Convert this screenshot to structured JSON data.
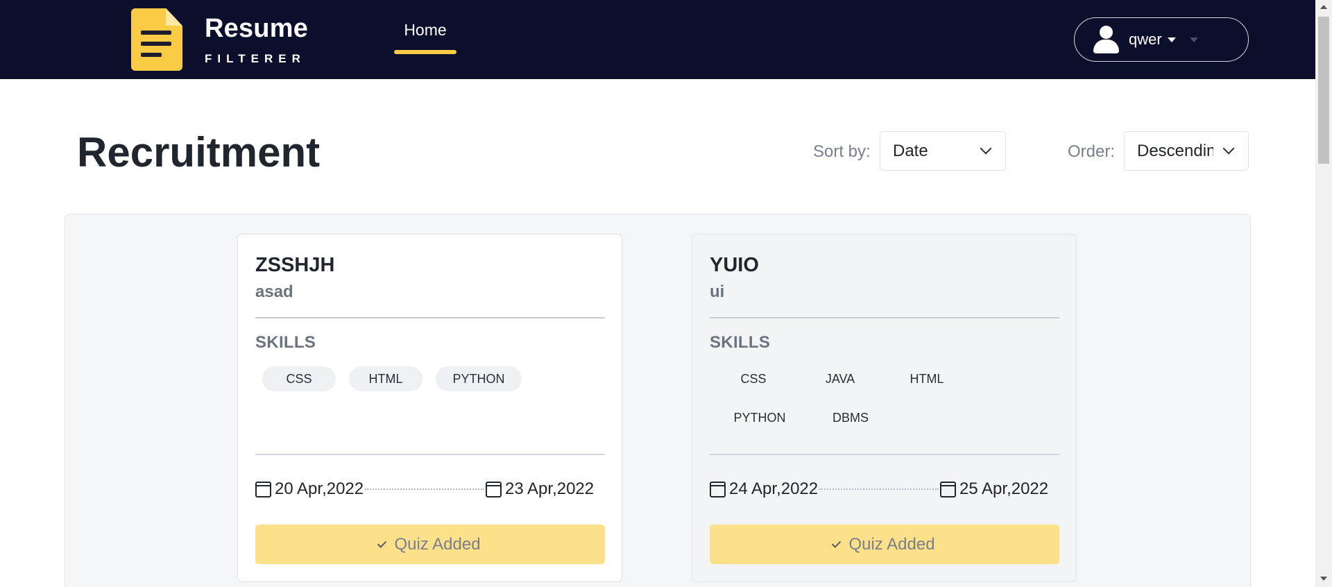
{
  "app": {
    "logo_title": "Resume",
    "logo_subtitle": "FILTERER",
    "nav_home": "Home",
    "user_name": "qwer"
  },
  "page": {
    "title": "Recruitment",
    "sort_label": "Sort by:",
    "sort_value": "Date",
    "order_label": "Order:",
    "order_value": "Descending"
  },
  "cards": [
    {
      "title": "ZSSHJH",
      "subtitle": "asad",
      "skills_heading": "SKILLS",
      "skills": [
        "CSS",
        "HTML",
        "PYTHON"
      ],
      "start_date": "20 Apr,2022",
      "end_date": "23 Apr,2022",
      "button_label": "Quiz Added"
    },
    {
      "title": "YUIO",
      "subtitle": "ui",
      "skills_heading": "SKILLS",
      "skills": [
        "CSS",
        "JAVA",
        "HTML",
        "PYTHON",
        "DBMS"
      ],
      "start_date": "24 Apr,2022",
      "end_date": "25 Apr,2022",
      "button_label": "Quiz Added"
    }
  ],
  "colors": {
    "navbar_bg": "#0c0f2b",
    "accent": "#fbcb45",
    "quiz_button": "#fde08a"
  }
}
